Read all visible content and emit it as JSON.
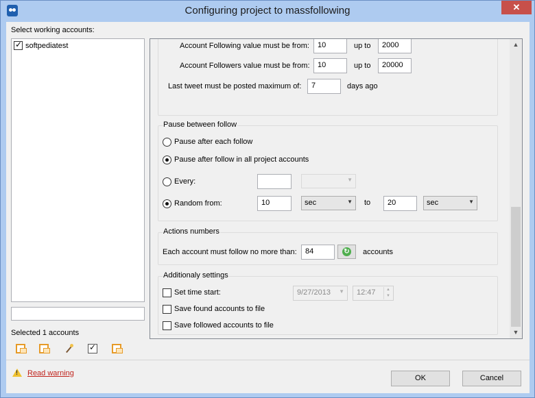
{
  "window": {
    "title": "Configuring project to massfollowing",
    "close_glyph": "✕"
  },
  "accounts": {
    "header": "Select working accounts:",
    "items": [
      {
        "label": "softpediatest",
        "checked": true
      }
    ],
    "filter_value": "",
    "selected_count": "Selected 1 accounts"
  },
  "filters": {
    "following_label": "Account Following value must be from:",
    "following_from": "10",
    "following_to": "2000",
    "followers_label": "Account Followers value must be from:",
    "followers_from": "10",
    "followers_to": "20000",
    "upto_label": "up to",
    "tweet_label": "Last tweet must be posted maximum of:",
    "tweet_days": "7",
    "days_ago": "days ago"
  },
  "pause": {
    "title": "Pause between follow",
    "opt_each": "Pause after each follow",
    "opt_all": "Pause after follow in all project accounts",
    "every_label": "Every:",
    "every_value": "",
    "every_unit": "",
    "random_label": "Random from:",
    "random_from": "10",
    "random_from_unit": "sec",
    "to_label": "to",
    "random_to": "20",
    "random_to_unit": "sec",
    "selected": [
      "all",
      "random"
    ]
  },
  "actions": {
    "title": "Actions numbers",
    "label": "Each account must follow no more than:",
    "value": "84",
    "unit": "accounts"
  },
  "additional": {
    "title": "Additionaly settings",
    "set_time_label": "Set time start:",
    "date": "9/27/2013",
    "time": "12:47",
    "save_found_label": "Save found accounts to file",
    "save_followed_label": "Save followed accounts to file"
  },
  "footer": {
    "warning_link": "Read warning",
    "ok": "OK",
    "cancel": "Cancel"
  },
  "colors": {
    "title_bar": "#aecbf0",
    "close_button": "#c7504a",
    "warning_link": "#c0221b"
  }
}
